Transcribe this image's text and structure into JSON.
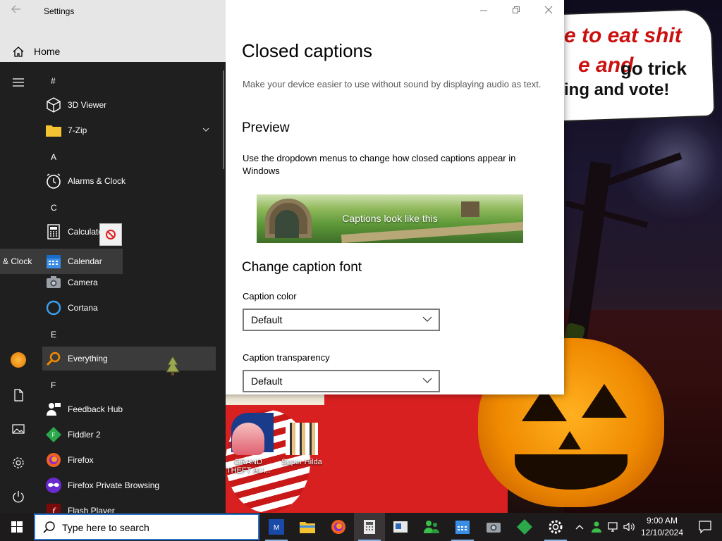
{
  "settings": {
    "app_title": "Settings",
    "home_label": "Home"
  },
  "page": {
    "title": "Closed captions",
    "description": "Make your device easier to use without sound by displaying audio as text.",
    "preview_heading": "Preview",
    "preview_description": "Use the dropdown menus to change how closed captions appear in Windows",
    "caption_sample": "Captions look like this",
    "font_heading": "Change caption font",
    "caption_color": {
      "label": "Caption color",
      "value": "Default"
    },
    "caption_transparency": {
      "label": "Caption transparency",
      "value": "Default"
    }
  },
  "start_menu": {
    "letters": {
      "hash": "#",
      "a": "A",
      "c": "C",
      "e": "E",
      "f": "F"
    },
    "apps": {
      "viewer3d": "3D Viewer",
      "zip": "7-Zip",
      "alarms": "Alarms & Clock",
      "calculator": "Calculator",
      "calendar": "Calendar",
      "camera": "Camera",
      "cortana": "Cortana",
      "everything": "Everything",
      "feedback": "Feedback Hub",
      "fiddler": "Fiddler 2",
      "firefox": "Firefox",
      "firefox_private": "Firefox Private Browsing",
      "flash": "Flash Player"
    },
    "drag_ghost_label": "& Clock"
  },
  "desktop": {
    "wallpaper_lines": [
      "e to eat shit",
      "e and",
      "go trick",
      "ing and vote!"
    ],
    "icons": {
      "gta": "GRAND THEFT AU...",
      "hilda": "Super Hilda"
    }
  },
  "taskbar": {
    "search_placeholder": "Type here to search",
    "clock_time": "9:00 AM",
    "clock_date": "12/10/2024"
  },
  "colors": {
    "start_bg": "#1f1f1f",
    "taskbar_bg": "#1e1b1c",
    "accent": "#2a73c8",
    "nav_bg": "#e6e6e6"
  }
}
